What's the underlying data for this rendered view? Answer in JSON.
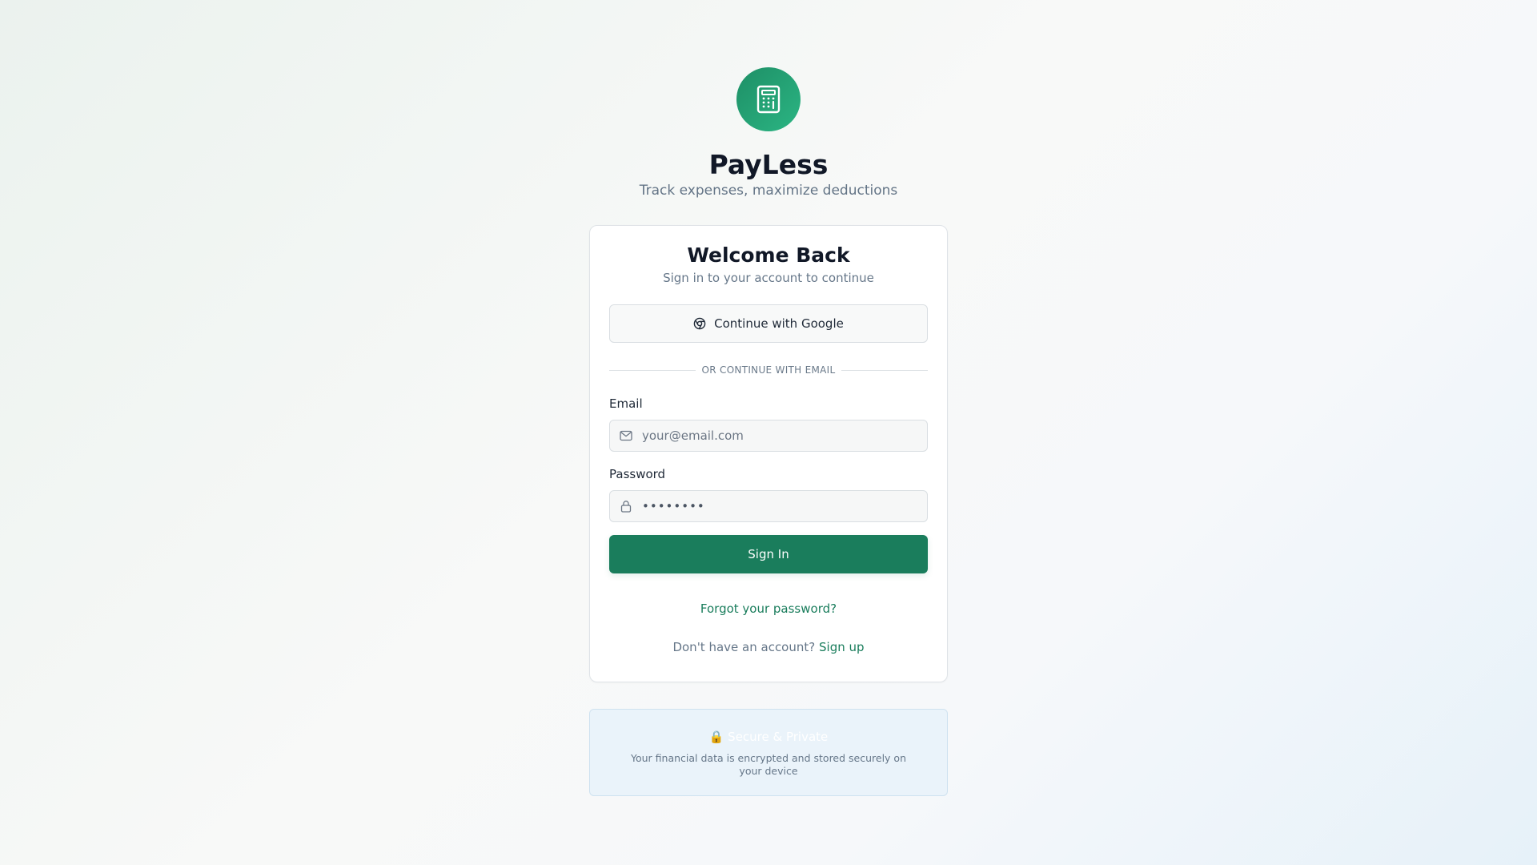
{
  "brand": {
    "logo_icon": "calculator-icon",
    "name": "PayLess",
    "tagline": "Track expenses, maximize deductions",
    "accent_color": "#1a7d5c"
  },
  "card": {
    "title": "Welcome Back",
    "subtitle": "Sign in to your account to continue",
    "google_button": {
      "icon": "chrome-icon",
      "label": "Continue with Google"
    },
    "divider_text": "OR CONTINUE WITH EMAIL",
    "email": {
      "label": "Email",
      "icon": "mail-icon",
      "value": "",
      "placeholder": "your@email.com"
    },
    "password": {
      "label": "Password",
      "icon": "lock-icon",
      "value": "••••••••",
      "placeholder": ""
    },
    "signin_label": "Sign In",
    "forgot_label": "Forgot your password?",
    "signup_prompt": "Don't have an account?",
    "signup_link": "Sign up"
  },
  "secure": {
    "lock_glyph": "🔒",
    "title": "Secure & Private",
    "description": "Your financial data is encrypted and stored securely on your device"
  }
}
